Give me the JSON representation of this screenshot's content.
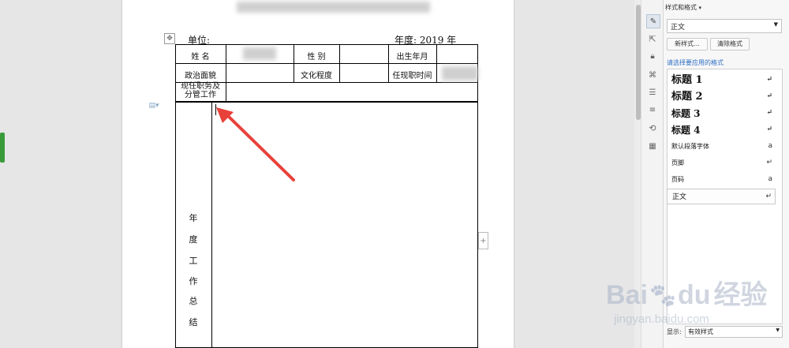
{
  "document": {
    "unit_label": "单位:",
    "year_label": "年度: 2019 年",
    "table": {
      "row1": {
        "name_label": "姓    名",
        "gender_label": "性      别",
        "birth_label": "出生年月"
      },
      "row2": {
        "politics_label": "政治面貌",
        "education_label": "文化程度",
        "tenure_label": "任现职时间"
      },
      "row3": {
        "position_label_line1": "现任职务及",
        "position_label_line2": "分管工作"
      },
      "summary_chars": [
        "年",
        "度",
        "工",
        "作",
        "总",
        "结"
      ]
    }
  },
  "panel": {
    "title": "样式和格式",
    "current_style": "正文",
    "new_style_button": "新样式...",
    "clear_format_button": "清除格式",
    "apply_prompt": "请选择要应用的格式",
    "styles": [
      {
        "label": "标题 1",
        "mark": "↵"
      },
      {
        "label": "标题 2",
        "mark": "↵"
      },
      {
        "label": "标题 3",
        "mark": "↵"
      },
      {
        "label": "标题 4",
        "mark": "↵"
      },
      {
        "label": "默认段落字体",
        "mark": "a"
      },
      {
        "label": "页脚",
        "mark": "↵"
      },
      {
        "label": "页码",
        "mark": "a"
      },
      {
        "label": "正文",
        "mark": "↵"
      }
    ],
    "show_label": "显示:",
    "show_value": "有效样式"
  },
  "watermark": {
    "brand": "Bai",
    "brand_suffix": "du",
    "cn": "经验",
    "url": "jingyan.baidu.com"
  },
  "colors": {
    "arrow": "#e8413a",
    "accent_link": "#2f6fc4"
  }
}
